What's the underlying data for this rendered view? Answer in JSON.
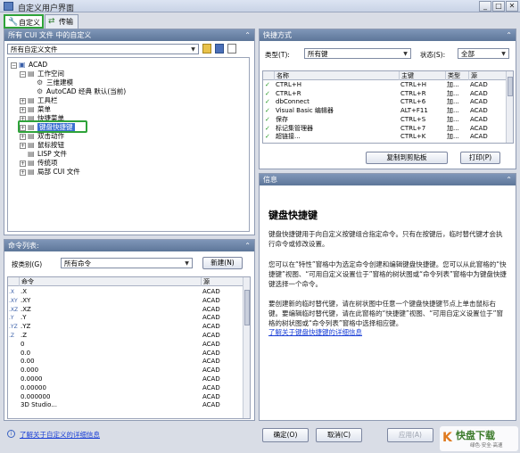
{
  "window": {
    "title": "自定义用户界面",
    "controls": [
      "_",
      "□",
      "✕"
    ]
  },
  "tabs": [
    {
      "label": "自定义",
      "icon": "wrench-icon"
    },
    {
      "label": "传输",
      "icon": "transfer-icon"
    }
  ],
  "left_top": {
    "header": "所有 CUI 文件 中的自定义",
    "file_select": "所有自定义文件",
    "tree": [
      {
        "label": "ACAD",
        "level": 0,
        "exp": "−"
      },
      {
        "label": "工作空间",
        "level": 1,
        "exp": "−"
      },
      {
        "label": "三维建模",
        "level": 2,
        "exp": ""
      },
      {
        "label": "AutoCAD 经典 默认(当前)",
        "level": 2,
        "exp": ""
      },
      {
        "label": "工具栏",
        "level": 1,
        "exp": "+"
      },
      {
        "label": "菜单",
        "level": 1,
        "exp": "+"
      },
      {
        "label": "快捷菜单",
        "level": 1,
        "exp": "+"
      },
      {
        "label": "键盘快捷键",
        "level": 1,
        "exp": "+"
      },
      {
        "label": "双击动作",
        "level": 1,
        "exp": "+"
      },
      {
        "label": "鼠标按钮",
        "level": 1,
        "exp": "+"
      },
      {
        "label": "LISP 文件",
        "level": 1,
        "exp": ""
      },
      {
        "label": "传统项",
        "level": 1,
        "exp": "+"
      },
      {
        "label": "局部 CUI 文件",
        "level": 1,
        "exp": "+"
      }
    ]
  },
  "left_bottom": {
    "header": "命令列表:",
    "filter_label": "按类别(G)",
    "filter_value": "所有命令",
    "new_button": "新建(N)",
    "columns": [
      "命令",
      "源"
    ],
    "rows": [
      {
        "icon": ".X",
        "cmd": ".X",
        "src": "ACAD"
      },
      {
        "icon": ".XY",
        "cmd": ".XY",
        "src": "ACAD"
      },
      {
        "icon": ".XZ",
        "cmd": ".XZ",
        "src": "ACAD"
      },
      {
        "icon": ".Y",
        "cmd": ".Y",
        "src": "ACAD"
      },
      {
        "icon": ".YZ",
        "cmd": ".YZ",
        "src": "ACAD"
      },
      {
        "icon": ".Z",
        "cmd": ".Z",
        "src": "ACAD"
      },
      {
        "icon": "",
        "cmd": "0",
        "src": "ACAD"
      },
      {
        "icon": "",
        "cmd": "0.0",
        "src": "ACAD"
      },
      {
        "icon": "",
        "cmd": "0.00",
        "src": "ACAD"
      },
      {
        "icon": "",
        "cmd": "0.000",
        "src": "ACAD"
      },
      {
        "icon": "",
        "cmd": "0.0000",
        "src": "ACAD"
      },
      {
        "icon": "",
        "cmd": "0.00000",
        "src": "ACAD"
      },
      {
        "icon": "",
        "cmd": "0.000000",
        "src": "ACAD"
      },
      {
        "icon": "",
        "cmd": "3D Studio...",
        "src": "ACAD"
      }
    ]
  },
  "shortcuts": {
    "header": "快捷方式",
    "type_label": "类型(T):",
    "type_value": "所有键",
    "status_label": "状态(S):",
    "status_value": "全部",
    "columns": [
      "名称",
      "主键",
      "类型",
      "源"
    ],
    "rows": [
      {
        "name": "CTRL+H",
        "key": "CTRL+H",
        "type": "加...",
        "src": "ACAD"
      },
      {
        "name": "CTRL+R",
        "key": "CTRL+R",
        "type": "加...",
        "src": "ACAD"
      },
      {
        "name": "dbConnect",
        "key": "CTRL+6",
        "type": "加...",
        "src": "ACAD"
      },
      {
        "name": "Visual Basic 编辑器",
        "key": "ALT+F11",
        "type": "加...",
        "src": "ACAD"
      },
      {
        "name": "保存",
        "key": "CTRL+S",
        "type": "加...",
        "src": "ACAD"
      },
      {
        "name": "标记集管理器",
        "key": "CTRL+7",
        "type": "加...",
        "src": "ACAD"
      },
      {
        "name": "超链接...",
        "key": "CTRL+K",
        "type": "加...",
        "src": "ACAD"
      }
    ],
    "copy_button": "复制到剪贴板",
    "print_button": "打印(P)"
  },
  "info": {
    "header": "信息",
    "title": "键盘快捷键",
    "p1": "键盘快捷键用于向自定义按键组合指定命令。只有在按键后，临时替代键才会执行命令或修改设置。",
    "p2": "您可以在“特性”窗格中为选定命令创建和编辑键盘快捷键。您可以从此窗格的“快捷键”视图、“可用自定义设置位于”窗格的树状图或“命令列表”窗格中为键盘快捷键选择一个命令。",
    "p3": "要创建新的临时替代键，请在树状图中任意一个键盘快捷键节点上单击鼠标右键。要编辑临时替代键，请在此窗格的“快捷键”视图、“可用自定义设置位于”窗格的树状图或“命令列表”窗格中选择相应键。",
    "link": "了解关于键盘快捷键的详细信息"
  },
  "footer": {
    "help_link": "了解关于自定义的详细信息",
    "ok": "确定(O)",
    "cancel": "取消(C)",
    "apply": "应用(A)",
    "watermark_brand": "快盘下载",
    "watermark_tag": "绿色·安全·高速"
  }
}
